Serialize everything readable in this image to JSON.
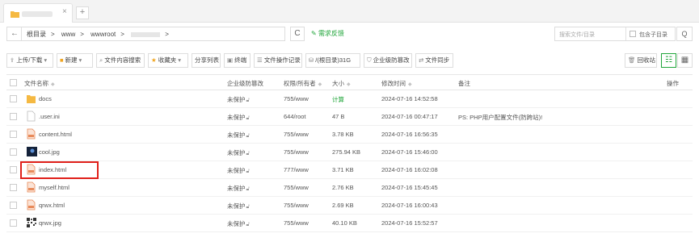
{
  "tabbar": {
    "add_label": "+"
  },
  "address": {
    "back_glyph": "←",
    "crumbs": [
      "根目录",
      "www",
      "wwwroot",
      ">"
    ],
    "refresh_glyph": "C",
    "feedback": "需求反馈"
  },
  "search": {
    "placeholder": "搜索文件/目录",
    "include_sub": "包含子目录",
    "button_glyph": "Q"
  },
  "toolbar": {
    "upload": "上传/下载",
    "new": "新建",
    "content_search": "文件内容搜索",
    "favorites": "收藏夹",
    "share_list": "分享列表",
    "terminal": "终端",
    "op_log": "文件操作记录",
    "disk": "/(根目录)31G",
    "tamper": "企业级防篡改",
    "sync": "文件同步",
    "recycle": "回收站"
  },
  "table": {
    "headers": {
      "name": "文件名称",
      "tamper": "企业级防篡改",
      "perm": "权限/所有者",
      "size": "大小",
      "mtime": "修改时间",
      "note": "备注",
      "action": "操作"
    },
    "rows": [
      {
        "icon": "folder-icon",
        "name": "docs",
        "tamper": "未保护",
        "perm": "755/www",
        "size": "计算",
        "mtime": "2024-07-16 14:52:58",
        "note": ""
      },
      {
        "icon": "file-icon",
        "name": ".user.ini",
        "tamper": "未保护",
        "perm": "644/root",
        "size": "47 B",
        "mtime": "2024-07-16 00:47:17",
        "note": "PS: PHP用户配置文件(防跨站)!"
      },
      {
        "icon": "html-icon",
        "name": "content.html",
        "tamper": "未保护",
        "perm": "755/www",
        "size": "3.78 KB",
        "mtime": "2024-07-16 16:56:35",
        "note": ""
      },
      {
        "icon": "image-icon",
        "name": "cool.jpg",
        "tamper": "未保护",
        "perm": "755/www",
        "size": "275.94 KB",
        "mtime": "2024-07-16 15:46:00",
        "note": ""
      },
      {
        "icon": "html-icon",
        "name": "index.html",
        "tamper": "未保护",
        "perm": "777/www",
        "size": "3.71 KB",
        "mtime": "2024-07-16 16:02:08",
        "note": ""
      },
      {
        "icon": "html-icon",
        "name": "myself.html",
        "tamper": "未保护",
        "perm": "755/www",
        "size": "2.76 KB",
        "mtime": "2024-07-16 15:45:45",
        "note": ""
      },
      {
        "icon": "html-icon",
        "name": "qrwx.html",
        "tamper": "未保护",
        "perm": "755/www",
        "size": "2.69 KB",
        "mtime": "2024-07-16 16:00:43",
        "note": ""
      },
      {
        "icon": "qrcode-icon",
        "name": "qrwx.jpg",
        "tamper": "未保护",
        "perm": "755/www",
        "size": "40.10 KB",
        "mtime": "2024-07-16 15:52:57",
        "note": ""
      }
    ]
  },
  "colors": {
    "accent": "#20a53a",
    "folder": "#f5b942",
    "highlight_border": "#e0201a"
  }
}
